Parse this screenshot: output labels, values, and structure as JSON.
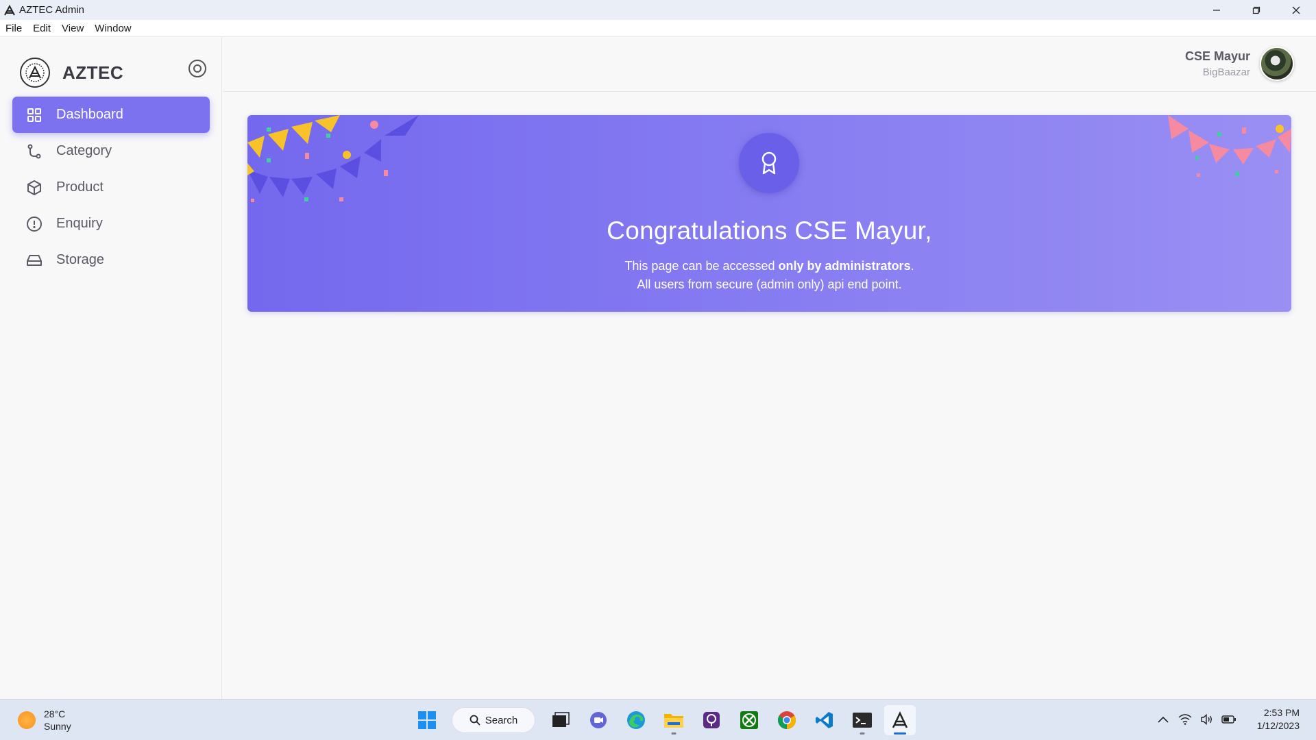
{
  "window": {
    "title": "AZTEC Admin"
  },
  "menu": [
    "File",
    "Edit",
    "View",
    "Window"
  ],
  "sidebar": {
    "brand": "AZTEC",
    "items": [
      {
        "label": "Dashboard",
        "icon": "grid-icon",
        "active": true
      },
      {
        "label": "Category",
        "icon": "branch-icon",
        "active": false
      },
      {
        "label": "Product",
        "icon": "box-icon",
        "active": false
      },
      {
        "label": "Enquiry",
        "icon": "alert-circle-icon",
        "active": false
      },
      {
        "label": "Storage",
        "icon": "hard-drive-icon",
        "active": false
      }
    ]
  },
  "header": {
    "user_name": "CSE Mayur",
    "store": "BigBaazar"
  },
  "banner": {
    "heading": "Congratulations CSE Mayur,",
    "line1_prefix": "This page can be accessed ",
    "line1_bold": "only by administrators",
    "line1_suffix": ".",
    "line2": "All users from secure (admin only) api end point."
  },
  "taskbar": {
    "weather_temp": "28°C",
    "weather_desc": "Sunny",
    "search_label": "Search",
    "time": "2:53 PM",
    "date": "1/12/2023"
  },
  "colors": {
    "accent": "#7c72f0",
    "banner": "#7468ee"
  }
}
